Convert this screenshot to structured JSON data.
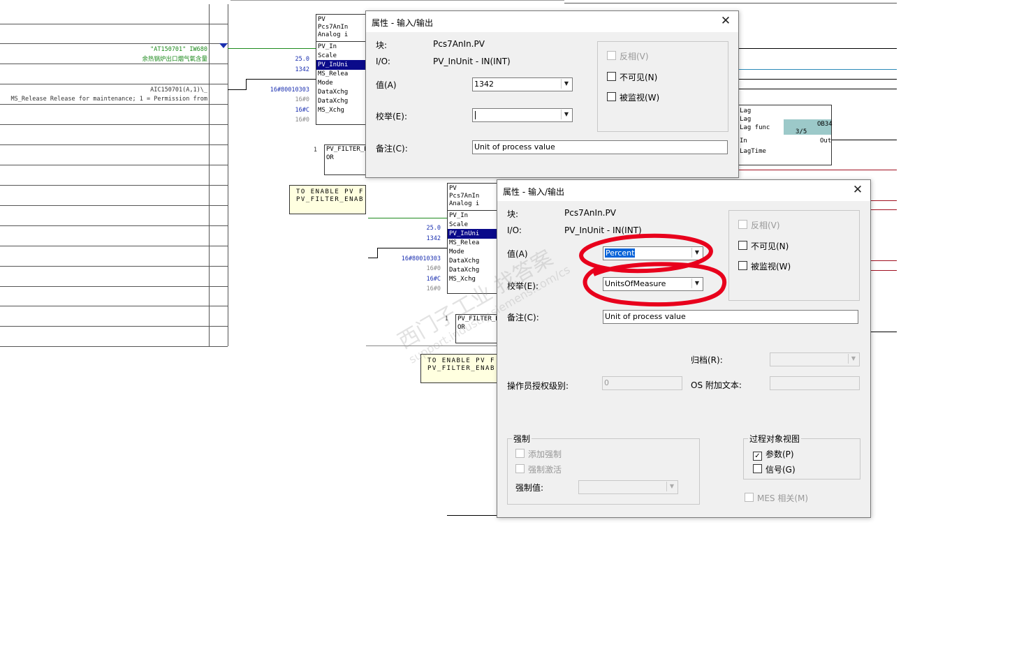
{
  "left_grid": {
    "tag_text": "\"AT150701\" IW680",
    "tag_desc": "余热锅炉出口烟气氧含量",
    "aic_text": "AIC150701(A,1)\\_",
    "ms_release_text": "MS_Release Release for maintenance; 1 = Permission from"
  },
  "block1": {
    "header": [
      "PV",
      "Pcs7AnIn",
      "Analog i"
    ],
    "pins": [
      "PV_In",
      "Scale",
      "PV_InUni",
      "MS_Relea",
      "Mode",
      "DataXchg",
      "DataXchg",
      "MS_Xchg"
    ],
    "inputs": [
      "25.0",
      "1342",
      "16#80010303",
      "16#0",
      "16#C",
      "16#0"
    ]
  },
  "block1_filter": {
    "index": "1",
    "lines": [
      "PV_FILTER_EN",
      "OR"
    ]
  },
  "note1": {
    "lines": [
      "TO ENABLE PV F",
      "PV_FILTER_ENAB"
    ]
  },
  "lag_block": {
    "lines": [
      "Lag",
      "Lag",
      "Lag func",
      "In",
      "LagTime"
    ],
    "ob": "OB34",
    "seq": "3/5",
    "out": "Out"
  },
  "block2": {
    "header": [
      "PV",
      "Pcs7AnIn",
      "Analog i"
    ],
    "pins": [
      "PV_In",
      "Scale",
      "PV_InUni",
      "MS_Relea",
      "Mode",
      "DataXchg",
      "DataXchg",
      "MS_Xchg"
    ],
    "inputs": [
      "25.0",
      "1342",
      "16#80010303",
      "16#0",
      "16#C",
      "16#0"
    ]
  },
  "block2_filter": {
    "index": "1",
    "lines": [
      "PV_FILTER_EN",
      "OR"
    ]
  },
  "note2": {
    "lines": [
      "TO ENABLE PV F",
      "PV_FILTER_ENAB"
    ]
  },
  "watermark": {
    "lines": [
      "西门子工业 找答案",
      "support.industry.siemens.com/cs"
    ]
  },
  "dialog1": {
    "title": "属性 - 输入/输出",
    "block_label": "块:",
    "block_value": "Pcs7AnIn.PV",
    "io_label": "I/O:",
    "io_value": "PV_InUnit - IN(INT)",
    "value_label": "值(A)",
    "value": "1342",
    "enum_label": "校举(E):",
    "enum_value": "",
    "comment_label": "备注(C):",
    "comment": "Unit of process value",
    "chk_invert": "反相(V)",
    "chk_invisible": "不可见(N)",
    "chk_watched": "被监视(W)"
  },
  "dialog2": {
    "title": "属性 - 输入/输出",
    "block_label": "块:",
    "block_value": "Pcs7AnIn.PV",
    "io_label": "I/O:",
    "io_value": "PV_InUnit - IN(INT)",
    "value_label": "值(A)",
    "value": "Percent",
    "enum_label": "校举(E):",
    "enum_value": "UnitsOfMeasure",
    "comment_label": "备注(C):",
    "comment": "Unit of process value",
    "chk_invert": "反相(V)",
    "chk_invisible": "不可见(N)",
    "chk_watched": "被监视(W)",
    "archive_label": "归档(R):",
    "operator_level_label": "操作员授权级别:",
    "operator_level_value": "0",
    "os_text_label": "OS 附加文本:",
    "force_group": "强制",
    "chk_add_force": "添加强制",
    "chk_force_active": "强制激活",
    "force_value_label": "强制值:",
    "pov_group": "过程对象视图",
    "chk_params": "参数(P)",
    "chk_signal": "信号(G)",
    "chk_mes": "MES 相关(M)",
    "annotation_color": "#e8001c"
  }
}
